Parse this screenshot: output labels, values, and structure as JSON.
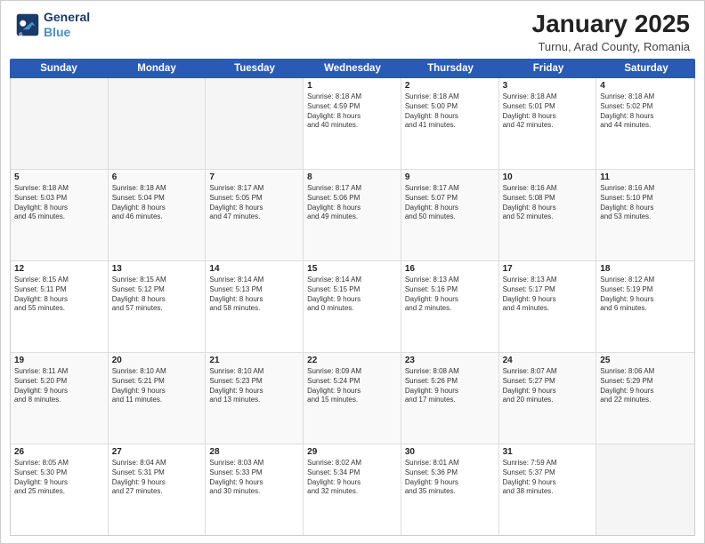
{
  "header": {
    "logo_line1": "General",
    "logo_line2": "Blue",
    "month": "January 2025",
    "location": "Turnu, Arad County, Romania"
  },
  "weekdays": [
    "Sunday",
    "Monday",
    "Tuesday",
    "Wednesday",
    "Thursday",
    "Friday",
    "Saturday"
  ],
  "rows": [
    [
      {
        "day": "",
        "text": "",
        "empty": true
      },
      {
        "day": "",
        "text": "",
        "empty": true
      },
      {
        "day": "",
        "text": "",
        "empty": true
      },
      {
        "day": "1",
        "text": "Sunrise: 8:18 AM\nSunset: 4:59 PM\nDaylight: 8 hours\nand 40 minutes."
      },
      {
        "day": "2",
        "text": "Sunrise: 8:18 AM\nSunset: 5:00 PM\nDaylight: 8 hours\nand 41 minutes."
      },
      {
        "day": "3",
        "text": "Sunrise: 8:18 AM\nSunset: 5:01 PM\nDaylight: 8 hours\nand 42 minutes."
      },
      {
        "day": "4",
        "text": "Sunrise: 8:18 AM\nSunset: 5:02 PM\nDaylight: 8 hours\nand 44 minutes."
      }
    ],
    [
      {
        "day": "5",
        "text": "Sunrise: 8:18 AM\nSunset: 5:03 PM\nDaylight: 8 hours\nand 45 minutes."
      },
      {
        "day": "6",
        "text": "Sunrise: 8:18 AM\nSunset: 5:04 PM\nDaylight: 8 hours\nand 46 minutes."
      },
      {
        "day": "7",
        "text": "Sunrise: 8:17 AM\nSunset: 5:05 PM\nDaylight: 8 hours\nand 47 minutes."
      },
      {
        "day": "8",
        "text": "Sunrise: 8:17 AM\nSunset: 5:06 PM\nDaylight: 8 hours\nand 49 minutes."
      },
      {
        "day": "9",
        "text": "Sunrise: 8:17 AM\nSunset: 5:07 PM\nDaylight: 8 hours\nand 50 minutes."
      },
      {
        "day": "10",
        "text": "Sunrise: 8:16 AM\nSunset: 5:08 PM\nDaylight: 8 hours\nand 52 minutes."
      },
      {
        "day": "11",
        "text": "Sunrise: 8:16 AM\nSunset: 5:10 PM\nDaylight: 8 hours\nand 53 minutes."
      }
    ],
    [
      {
        "day": "12",
        "text": "Sunrise: 8:15 AM\nSunset: 5:11 PM\nDaylight: 8 hours\nand 55 minutes."
      },
      {
        "day": "13",
        "text": "Sunrise: 8:15 AM\nSunset: 5:12 PM\nDaylight: 8 hours\nand 57 minutes."
      },
      {
        "day": "14",
        "text": "Sunrise: 8:14 AM\nSunset: 5:13 PM\nDaylight: 8 hours\nand 58 minutes."
      },
      {
        "day": "15",
        "text": "Sunrise: 8:14 AM\nSunset: 5:15 PM\nDaylight: 9 hours\nand 0 minutes."
      },
      {
        "day": "16",
        "text": "Sunrise: 8:13 AM\nSunset: 5:16 PM\nDaylight: 9 hours\nand 2 minutes."
      },
      {
        "day": "17",
        "text": "Sunrise: 8:13 AM\nSunset: 5:17 PM\nDaylight: 9 hours\nand 4 minutes."
      },
      {
        "day": "18",
        "text": "Sunrise: 8:12 AM\nSunset: 5:19 PM\nDaylight: 9 hours\nand 6 minutes."
      }
    ],
    [
      {
        "day": "19",
        "text": "Sunrise: 8:11 AM\nSunset: 5:20 PM\nDaylight: 9 hours\nand 8 minutes."
      },
      {
        "day": "20",
        "text": "Sunrise: 8:10 AM\nSunset: 5:21 PM\nDaylight: 9 hours\nand 11 minutes."
      },
      {
        "day": "21",
        "text": "Sunrise: 8:10 AM\nSunset: 5:23 PM\nDaylight: 9 hours\nand 13 minutes."
      },
      {
        "day": "22",
        "text": "Sunrise: 8:09 AM\nSunset: 5:24 PM\nDaylight: 9 hours\nand 15 minutes."
      },
      {
        "day": "23",
        "text": "Sunrise: 8:08 AM\nSunset: 5:26 PM\nDaylight: 9 hours\nand 17 minutes."
      },
      {
        "day": "24",
        "text": "Sunrise: 8:07 AM\nSunset: 5:27 PM\nDaylight: 9 hours\nand 20 minutes."
      },
      {
        "day": "25",
        "text": "Sunrise: 8:06 AM\nSunset: 5:29 PM\nDaylight: 9 hours\nand 22 minutes."
      }
    ],
    [
      {
        "day": "26",
        "text": "Sunrise: 8:05 AM\nSunset: 5:30 PM\nDaylight: 9 hours\nand 25 minutes."
      },
      {
        "day": "27",
        "text": "Sunrise: 8:04 AM\nSunset: 5:31 PM\nDaylight: 9 hours\nand 27 minutes."
      },
      {
        "day": "28",
        "text": "Sunrise: 8:03 AM\nSunset: 5:33 PM\nDaylight: 9 hours\nand 30 minutes."
      },
      {
        "day": "29",
        "text": "Sunrise: 8:02 AM\nSunset: 5:34 PM\nDaylight: 9 hours\nand 32 minutes."
      },
      {
        "day": "30",
        "text": "Sunrise: 8:01 AM\nSunset: 5:36 PM\nDaylight: 9 hours\nand 35 minutes."
      },
      {
        "day": "31",
        "text": "Sunrise: 7:59 AM\nSunset: 5:37 PM\nDaylight: 9 hours\nand 38 minutes."
      },
      {
        "day": "",
        "text": "",
        "empty": true
      }
    ]
  ]
}
